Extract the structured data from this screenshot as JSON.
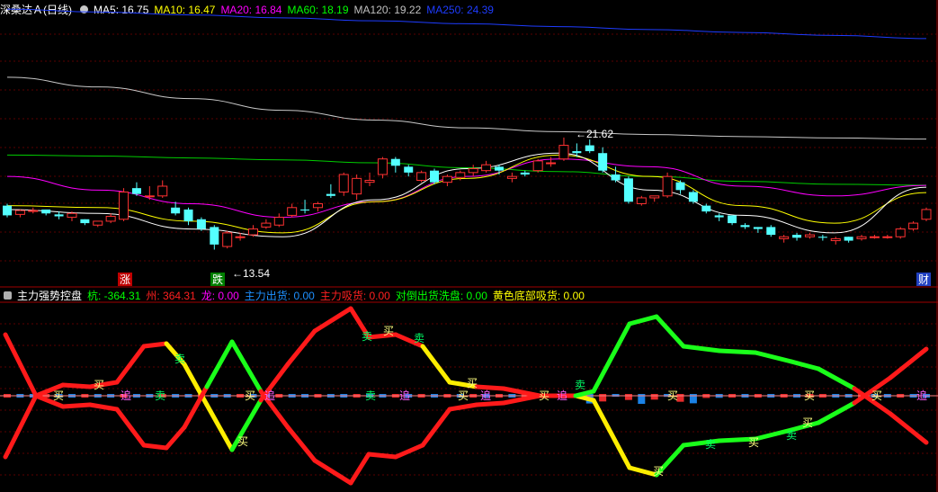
{
  "top": {
    "stock_name": "深桑达Ａ",
    "period": "(日线)",
    "ma": [
      {
        "label": "MA5: 16.75",
        "color": "#ffffff"
      },
      {
        "label": "MA10: 16.47",
        "color": "#ffff00"
      },
      {
        "label": "MA20: 16.84",
        "color": "#ff00ff"
      },
      {
        "label": "MA60: 18.19",
        "color": "#00ff00"
      },
      {
        "label": "MA120: 19.22",
        "color": "#c0c0c0"
      },
      {
        "label": "MA250: 24.39",
        "color": "#1e3cff"
      }
    ],
    "high_label": "21.62",
    "low_label": "13.54",
    "markers": [
      "涨",
      "跌",
      "财"
    ]
  },
  "bottom": {
    "indicator_name": "主力强势控盘",
    "values": [
      {
        "label": "杭: -364.31",
        "color": "#00ff00"
      },
      {
        "label": "州: 364.31",
        "color": "#ff2020"
      },
      {
        "label": "龙: 0.00",
        "color": "#ff00ff"
      },
      {
        "label": "主力出货: 0.00",
        "color": "#1e90ff"
      },
      {
        "label": "主力吸货: 0.00",
        "color": "#ff2020"
      },
      {
        "label": "对倒出货洗盘: 0.00",
        "color": "#00ff00"
      },
      {
        "label": "黄色底部吸货: 0.00",
        "color": "#ffff00"
      }
    ],
    "signal_labels": {
      "buy": "买",
      "sell": "卖",
      "chase": "追"
    }
  },
  "chart_data": {
    "type": "candlestick",
    "y_range": [
      12.5,
      26.0
    ],
    "candles": [
      {
        "o": 15.8,
        "c": 15.3,
        "h": 15.9,
        "l": 15.2
      },
      {
        "o": 15.35,
        "c": 15.55,
        "h": 15.6,
        "l": 15.2
      },
      {
        "o": 15.5,
        "c": 15.55,
        "h": 15.7,
        "l": 15.4
      },
      {
        "o": 15.6,
        "c": 15.4,
        "h": 15.6,
        "l": 15.3
      },
      {
        "o": 15.35,
        "c": 15.25,
        "h": 15.5,
        "l": 15.1
      },
      {
        "o": 15.2,
        "c": 15.4,
        "h": 15.5,
        "l": 15.0
      },
      {
        "o": 15.1,
        "c": 14.9,
        "h": 15.1,
        "l": 14.8
      },
      {
        "o": 14.8,
        "c": 15.0,
        "h": 15.0,
        "l": 14.7
      },
      {
        "o": 15.0,
        "c": 15.25,
        "h": 15.4,
        "l": 14.9
      },
      {
        "o": 15.1,
        "c": 16.5,
        "h": 16.7,
        "l": 15.0
      },
      {
        "o": 16.7,
        "c": 16.4,
        "h": 17.0,
        "l": 16.3
      },
      {
        "o": 16.3,
        "c": 16.3,
        "h": 16.8,
        "l": 16.1
      },
      {
        "o": 16.3,
        "c": 16.8,
        "h": 17.1,
        "l": 16.2
      },
      {
        "o": 15.7,
        "c": 15.4,
        "h": 16.0,
        "l": 15.3
      },
      {
        "o": 15.6,
        "c": 15.0,
        "h": 15.7,
        "l": 14.8
      },
      {
        "o": 15.1,
        "c": 14.6,
        "h": 15.2,
        "l": 14.5
      },
      {
        "o": 14.7,
        "c": 13.8,
        "h": 14.8,
        "l": 13.54
      },
      {
        "o": 13.7,
        "c": 14.4,
        "h": 14.5,
        "l": 13.6
      },
      {
        "o": 14.2,
        "c": 14.2,
        "h": 14.4,
        "l": 14.0
      },
      {
        "o": 14.3,
        "c": 14.6,
        "h": 14.8,
        "l": 14.2
      },
      {
        "o": 14.7,
        "c": 14.9,
        "h": 15.1,
        "l": 14.6
      },
      {
        "o": 14.8,
        "c": 15.2,
        "h": 15.4,
        "l": 14.7
      },
      {
        "o": 15.3,
        "c": 15.7,
        "h": 15.9,
        "l": 15.2
      },
      {
        "o": 15.6,
        "c": 15.55,
        "h": 16.1,
        "l": 15.4
      },
      {
        "o": 15.7,
        "c": 15.9,
        "h": 16.0,
        "l": 15.5
      },
      {
        "o": 16.4,
        "c": 16.3,
        "h": 16.9,
        "l": 16.2
      },
      {
        "o": 16.5,
        "c": 17.4,
        "h": 17.5,
        "l": 16.3
      },
      {
        "o": 16.4,
        "c": 17.2,
        "h": 17.4,
        "l": 16.1
      },
      {
        "o": 17.0,
        "c": 17.1,
        "h": 17.5,
        "l": 16.8
      },
      {
        "o": 17.4,
        "c": 18.2,
        "h": 18.3,
        "l": 17.2
      },
      {
        "o": 18.2,
        "c": 17.85,
        "h": 18.3,
        "l": 17.5
      },
      {
        "o": 17.8,
        "c": 17.5,
        "h": 17.9,
        "l": 17.3
      },
      {
        "o": 17.1,
        "c": 17.5,
        "h": 17.6,
        "l": 17.0
      },
      {
        "o": 17.6,
        "c": 17.0,
        "h": 17.7,
        "l": 16.9
      },
      {
        "o": 17.0,
        "c": 17.3,
        "h": 17.4,
        "l": 16.8
      },
      {
        "o": 17.25,
        "c": 17.5,
        "h": 17.6,
        "l": 17.1
      },
      {
        "o": 17.5,
        "c": 17.7,
        "h": 17.9,
        "l": 17.3
      },
      {
        "o": 17.6,
        "c": 17.9,
        "h": 18.1,
        "l": 17.5
      },
      {
        "o": 17.8,
        "c": 17.6,
        "h": 17.9,
        "l": 17.4
      },
      {
        "o": 17.2,
        "c": 17.3,
        "h": 17.5,
        "l": 17.0
      },
      {
        "o": 17.5,
        "c": 17.4,
        "h": 17.6,
        "l": 17.3
      },
      {
        "o": 17.6,
        "c": 18.1,
        "h": 18.2,
        "l": 17.5
      },
      {
        "o": 18.0,
        "c": 18.0,
        "h": 18.3,
        "l": 17.8
      },
      {
        "o": 18.2,
        "c": 18.9,
        "h": 19.3,
        "l": 18.1
      },
      {
        "o": 18.6,
        "c": 18.5,
        "h": 19.0,
        "l": 18.3
      },
      {
        "o": 18.9,
        "c": 18.6,
        "h": 19.2,
        "l": 18.5
      },
      {
        "o": 18.5,
        "c": 17.6,
        "h": 18.8,
        "l": 17.5
      },
      {
        "o": 17.4,
        "c": 17.1,
        "h": 17.8,
        "l": 17.0
      },
      {
        "o": 17.2,
        "c": 16.0,
        "h": 17.3,
        "l": 15.9
      },
      {
        "o": 15.9,
        "c": 16.2,
        "h": 16.3,
        "l": 15.8
      },
      {
        "o": 16.2,
        "c": 16.3,
        "h": 16.3,
        "l": 16.0
      },
      {
        "o": 16.3,
        "c": 17.3,
        "h": 17.5,
        "l": 16.2
      },
      {
        "o": 17.0,
        "c": 16.6,
        "h": 17.1,
        "l": 16.4
      },
      {
        "o": 16.5,
        "c": 16.0,
        "h": 16.6,
        "l": 15.9
      },
      {
        "o": 15.8,
        "c": 15.5,
        "h": 15.9,
        "l": 15.4
      },
      {
        "o": 15.3,
        "c": 15.2,
        "h": 15.4,
        "l": 15.0
      },
      {
        "o": 15.3,
        "c": 14.9,
        "h": 15.3,
        "l": 14.8
      },
      {
        "o": 14.8,
        "c": 14.7,
        "h": 14.9,
        "l": 14.6
      },
      {
        "o": 14.7,
        "c": 14.6,
        "h": 14.7,
        "l": 14.4
      },
      {
        "o": 14.7,
        "c": 14.3,
        "h": 14.8,
        "l": 14.2
      },
      {
        "o": 14.1,
        "c": 14.2,
        "h": 14.3,
        "l": 13.9
      },
      {
        "o": 14.3,
        "c": 14.15,
        "h": 14.4,
        "l": 14.0
      },
      {
        "o": 14.2,
        "c": 14.3,
        "h": 14.4,
        "l": 14.1
      },
      {
        "o": 14.2,
        "c": 14.15,
        "h": 14.3,
        "l": 14.0
      },
      {
        "o": 14.0,
        "c": 14.1,
        "h": 14.2,
        "l": 13.8
      },
      {
        "o": 14.2,
        "c": 14.0,
        "h": 14.2,
        "l": 13.9
      },
      {
        "o": 14.1,
        "c": 14.2,
        "h": 14.3,
        "l": 14.0
      },
      {
        "o": 14.2,
        "c": 14.2,
        "h": 14.3,
        "l": 14.1
      },
      {
        "o": 14.2,
        "c": 14.2,
        "h": 14.3,
        "l": 14.1
      },
      {
        "o": 14.2,
        "c": 14.6,
        "h": 14.7,
        "l": 14.1
      },
      {
        "o": 14.6,
        "c": 14.9,
        "h": 15.0,
        "l": 14.5
      },
      {
        "o": 15.1,
        "c": 15.6,
        "h": 15.7,
        "l": 15.0
      }
    ],
    "ma_lines": {
      "MA250": [
        25.9,
        25.75,
        25.6,
        25.45,
        25.3,
        25.15,
        25.0,
        24.85,
        24.7,
        24.55,
        24.39
      ],
      "MA120": [
        22.4,
        21.9,
        21.3,
        20.7,
        20.2,
        19.8,
        19.6,
        19.45,
        19.35,
        19.28,
        19.22
      ],
      "MA60": [
        18.4,
        18.35,
        18.25,
        18.15,
        18.0,
        17.75,
        17.55,
        17.3,
        17.05,
        16.9,
        16.85
      ],
      "MA20": [
        17.3,
        16.6,
        15.9,
        15.2,
        16.0,
        17.3,
        18.2,
        17.8,
        16.8,
        16.3,
        16.84
      ],
      "MA10": [
        15.8,
        15.7,
        15.0,
        14.4,
        16.0,
        17.2,
        18.4,
        17.3,
        15.8,
        14.9,
        16.47
      ],
      "MA5": [
        15.6,
        15.4,
        14.6,
        14.2,
        16.1,
        17.7,
        18.5,
        16.6,
        15.3,
        14.4,
        16.75
      ]
    }
  }
}
